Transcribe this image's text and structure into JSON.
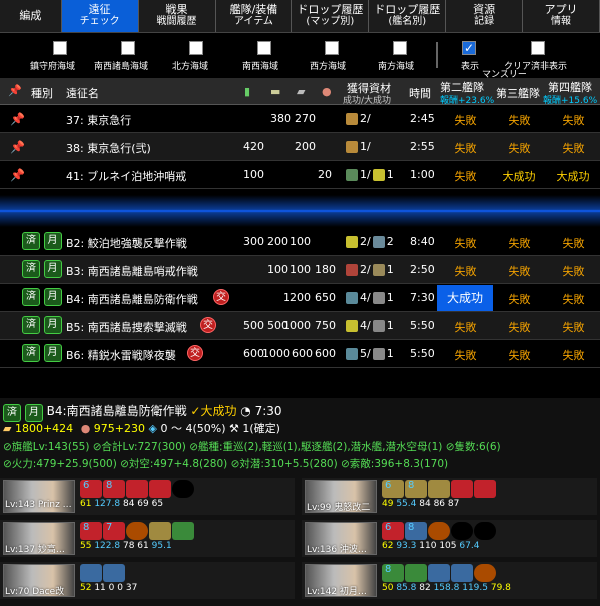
{
  "tabs": [
    {
      "line1": "編成",
      "line2": ""
    },
    {
      "line1": "遠征",
      "line2": "チェック"
    },
    {
      "line1": "戦果",
      "line2": "戦闘履歴"
    },
    {
      "line1": "艦隊/装備",
      "line2": "アイテム"
    },
    {
      "line1": "ドロップ履歴",
      "line2": "(マップ別)"
    },
    {
      "line1": "ドロップ履歴",
      "line2": "(艦名別)"
    },
    {
      "line1": "資源",
      "line2": "記録"
    },
    {
      "line1": "アプリ",
      "line2": "情報"
    }
  ],
  "filters": {
    "areas": [
      "鎮守府海域",
      "南西諸島海域",
      "北方海域",
      "南西海域",
      "西方海域",
      "南方海域"
    ],
    "monthly": "マンスリー",
    "show": "表示",
    "clear_hide": "クリア済非表示",
    "show_checkmark": "✓"
  },
  "header": {
    "type": "種別",
    "name": "遠征名",
    "acquired": "獲得資材",
    "acquired_sub": "成功/大成功",
    "time": "時間",
    "fleet2": "第二艦隊",
    "fleet2_sub": "報酬+23.6%",
    "fleet3": "第三艦隊",
    "fleet4": "第四艦隊",
    "fleet4_sub": "報酬+15.6%"
  },
  "pinned_rows": [
    {
      "name": "37: 東京急行",
      "fuel": "",
      "ammo": "380",
      "steel": "270",
      "baux": "",
      "reward": "2/",
      "time": "2:45",
      "f2": "失敗",
      "f3": "失敗",
      "f4": "失敗"
    },
    {
      "name": "38: 東京急行(弐)",
      "fuel": "420",
      "ammo": "",
      "steel": "200",
      "baux": "",
      "reward": "1/",
      "time": "2:55",
      "f2": "失敗",
      "f3": "失敗",
      "f4": "失敗"
    },
    {
      "name": "41: ブルネイ泊地沖哨戒",
      "fuel": "100",
      "ammo": "",
      "steel": "",
      "baux": "20",
      "reward": "1/",
      "reward2": "1",
      "time": "1:00",
      "f2": "失敗",
      "f3": "大成功",
      "f4": "大成功"
    }
  ],
  "monthly_rows": [
    {
      "done": "済",
      "type": "月",
      "name": "B2: 鮫泊地強襲反撃作戦",
      "fuel": "300",
      "ammo": "200",
      "steel": "100",
      "baux": "",
      "reward": "2/",
      "reward2": "2",
      "time": "8:40",
      "f2": "失敗",
      "f3": "失敗",
      "f4": "失敗",
      "badge": ""
    },
    {
      "done": "済",
      "type": "月",
      "name": "B3: 南西諸島離島哨戒作戦",
      "fuel": "",
      "ammo": "100",
      "steel": "100",
      "baux": "180",
      "reward": "2/",
      "reward2": "1",
      "time": "2:50",
      "f2": "失敗",
      "f3": "失敗",
      "f4": "失敗",
      "badge": ""
    },
    {
      "done": "済",
      "type": "月",
      "name": "B4: 南西諸島離島防衛作戦",
      "fuel": "",
      "ammo": "",
      "steel": "1200",
      "baux": "650",
      "reward": "4/",
      "reward2": "1",
      "time": "7:30",
      "f2": "大成功",
      "f3": "失敗",
      "f4": "失敗",
      "badge": "交"
    },
    {
      "done": "済",
      "type": "月",
      "name": "B5: 南西諸島捜索撃滅戦",
      "fuel": "500",
      "ammo": "500",
      "steel": "1000",
      "baux": "750",
      "reward": "4/",
      "reward2": "1",
      "time": "5:50",
      "f2": "失敗",
      "f3": "失敗",
      "f4": "失敗",
      "badge": "交"
    },
    {
      "done": "済",
      "type": "月",
      "name": "B6: 精鋭水雷戦隊夜襲",
      "fuel": "600",
      "ammo": "1000",
      "steel": "600",
      "baux": "600",
      "reward": "5/",
      "reward2": "1",
      "time": "5:50",
      "f2": "失敗",
      "f3": "失敗",
      "f4": "失敗",
      "badge": "交"
    }
  ],
  "detail": {
    "done": "済",
    "type": "月",
    "title": "B4:南西諸島離島防衛作戦",
    "result": "✓大成功",
    "time": "7:30",
    "line2": {
      "a": "1800+424",
      "b": "975+230",
      "c": "0 〜 4(50%)",
      "d": "1(確定)"
    },
    "line3": "⊘旗艦Lv:143(55) ⊘合計Lv:727(300) ⊘艦種:重巡(2),軽巡(1),駆逐艦(2),潜水艦,潜水空母(1) ⊘隻数:6(6)",
    "line4": "⊘火力:479+25.9(500) ⊘対空:497+4.8(280) ⊘対潜:310+5.5(280) ⊘索敵:396+8.3(170)"
  },
  "ships": [
    {
      "lv": "Lv:143 Prinz …",
      "slots": [
        "6",
        "8",
        "",
        "",
        ""
      ],
      "cond": "61",
      "s1": "127.8",
      "s2": "84",
      "s3": "69",
      "s4": "65"
    },
    {
      "lv": "Lv:99 鬼怒改二",
      "slots": [
        "6",
        "8",
        "",
        "",
        ""
      ],
      "cond": "49",
      "s1": "55.4",
      "s2": "84",
      "s3": "86",
      "s4": "87"
    },
    {
      "lv": "Lv:137 妙高…",
      "slots": [
        "8",
        "7",
        "",
        "",
        ""
      ],
      "cond": "55",
      "s1": "122.8",
      "s2": "78",
      "s3": "61",
      "s4": "95.1"
    },
    {
      "lv": "Lv:136 沖波…",
      "slots": [
        "6",
        "8",
        "",
        "",
        ""
      ],
      "cond": "62",
      "s1": "93.3",
      "s2": "110",
      "s3": "105",
      "s4": "67.4"
    },
    {
      "lv": "Lv:70 Dace改",
      "slots": [
        "",
        "",
        "",
        "",
        ""
      ],
      "cond": "52",
      "s1": "11",
      "s2": "0",
      "s3": "0",
      "s4": "37"
    },
    {
      "lv": "Lv:142 初月…",
      "slots": [
        "8",
        "",
        "",
        "",
        ""
      ],
      "cond": "50",
      "s1": "85.8",
      "s2": "82",
      "s3": "158.8",
      "s4": "119.5",
      "s5": "79.8"
    }
  ]
}
